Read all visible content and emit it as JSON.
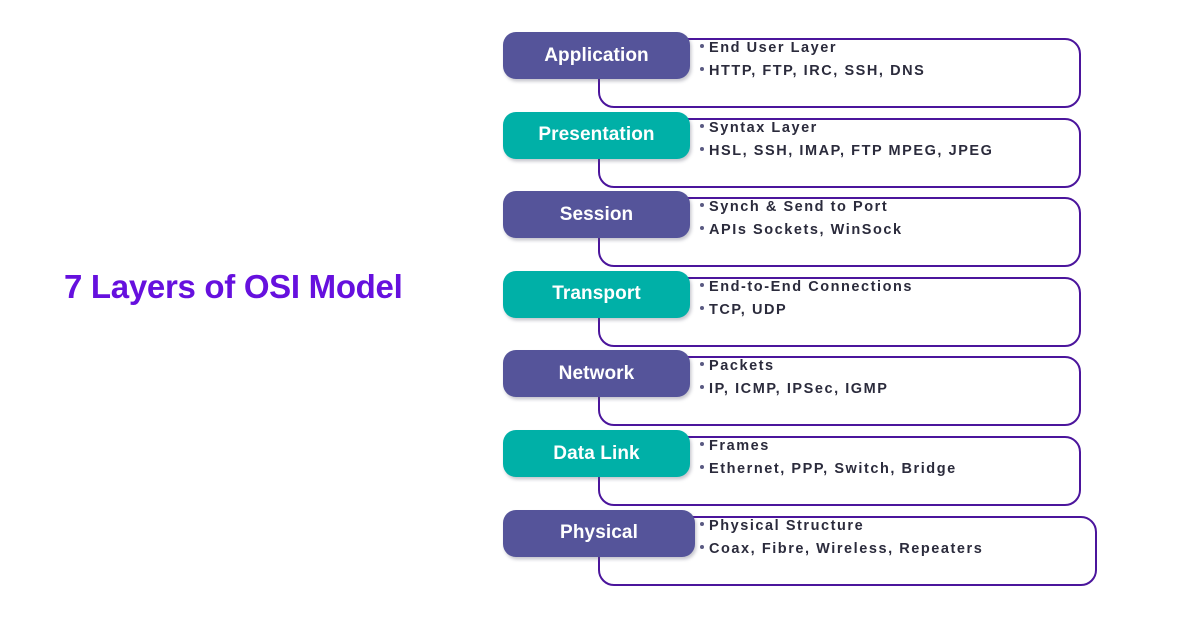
{
  "title": "7 Layers of OSI Model",
  "colors": {
    "title_purple": "#6610de",
    "pill_purple": "#55549a",
    "pill_teal": "#00b0a7",
    "box_border": "#4b159c",
    "bullet_text": "#2b2b3c",
    "bullet_dot": "#5a5a82",
    "background": "#ffffff"
  },
  "layers": [
    {
      "name": "Application",
      "accent": "#55549a",
      "accent_name": "pill_purple",
      "bullets": [
        "End User Layer",
        "HTTP, FTP, IRC, SSH, DNS"
      ]
    },
    {
      "name": "Presentation",
      "accent": "#00b0a7",
      "accent_name": "pill_teal",
      "bullets": [
        "Syntax Layer",
        "HSL, SSH, IMAP, FTP MPEG, JPEG"
      ]
    },
    {
      "name": "Session",
      "accent": "#55549a",
      "accent_name": "pill_purple",
      "bullets": [
        "Synch & Send to Port",
        "APIs Sockets, WinSock"
      ]
    },
    {
      "name": "Transport",
      "accent": "#00b0a7",
      "accent_name": "pill_teal",
      "bullets": [
        "End-to-End Connections",
        "TCP, UDP"
      ]
    },
    {
      "name": "Network",
      "accent": "#55549a",
      "accent_name": "pill_purple",
      "bullets": [
        "Packets",
        "IP, ICMP, IPSec, IGMP"
      ]
    },
    {
      "name": "Data Link",
      "accent": "#00b0a7",
      "accent_name": "pill_teal",
      "bullets": [
        "Frames",
        "Ethernet, PPP, Switch, Bridge"
      ]
    },
    {
      "name": "Physical",
      "accent": "#55549a",
      "accent_name": "pill_purple",
      "bullets": [
        "Physical Structure",
        "Coax, Fibre, Wireless, Repeaters"
      ]
    }
  ]
}
